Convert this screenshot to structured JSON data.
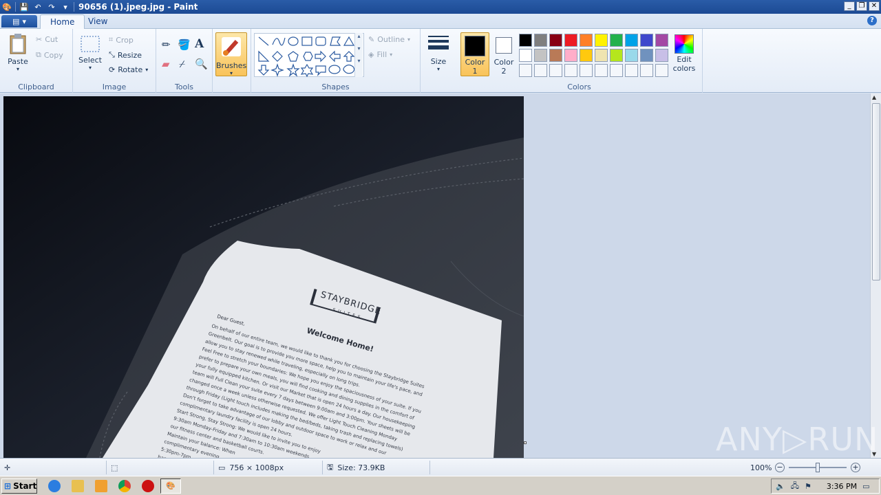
{
  "window": {
    "title": "90656 (1).jpeg.jpg - Paint",
    "minimize": "_",
    "restore": "❐",
    "close": "✕"
  },
  "tabs": {
    "home": "Home",
    "view": "View",
    "help": "?"
  },
  "clipboard": {
    "paste": "Paste",
    "cut": "Cut",
    "copy": "Copy",
    "label": "Clipboard"
  },
  "image": {
    "select": "Select",
    "crop": "Crop",
    "resize": "Resize",
    "rotate": "Rotate",
    "label": "Image"
  },
  "tools": {
    "label": "Tools",
    "text_glyph": "A"
  },
  "brushes": {
    "label": "Brushes"
  },
  "shapes": {
    "outline": "Outline",
    "fill": "Fill",
    "label": "Shapes"
  },
  "size": {
    "label": "Size"
  },
  "color1": {
    "label1": "Color",
    "label2": "1",
    "value": "#000000"
  },
  "color2": {
    "label1": "Color",
    "label2": "2",
    "value": "#ffffff"
  },
  "colors": {
    "label": "Colors",
    "row1": [
      "#000000",
      "#7f7f7f",
      "#880015",
      "#ed1c24",
      "#ff7f27",
      "#fff200",
      "#22b14c",
      "#00a2e8",
      "#3f48cc",
      "#a349a4"
    ],
    "row2": [
      "#ffffff",
      "#c3c3c3",
      "#b97a57",
      "#ffaec9",
      "#ffc90e",
      "#efe4b0",
      "#b5e61d",
      "#99d9ea",
      "#7092be",
      "#c8bfe7"
    ],
    "edit1": "Edit",
    "edit2": "colors"
  },
  "document": {
    "logo": "STAYBRIDGE",
    "logo_sub": "SUITES",
    "greeting": "Dear Guest,",
    "heading": "Welcome Home!",
    "lines": [
      "On behalf of our entire team, we would like to thank you for choosing the Staybridge Suites",
      "Greenbelt. Our goal is to provide you more space, help you to maintain your life's pace, and",
      "allow you to stay renewed while traveling, especially on long trips.",
      "Feel Free to stretch your boundaries: We hope you enjoy the spaciousness of your suite. If you",
      "prefer to prepare your own meals, you will find cooking and dining supplies in the comfort of",
      "your fully equipped kitchen. Or visit our Market that is open 24 hours a day. Our housekeeping",
      "team will Full Clean your suite every 7 days between 9:00am and 3:00pm. Your sheets will be",
      "changed once a week unless otherwise requested. We offer Light Touch Cleaning Monday",
      "through Friday (Light touch includes making the bed/beds, taking trash and replacing towels)",
      "Don't forget to take advantage of our lobby and outdoor space to work or relax and our",
      "complimentary laundry facility is open 24 hours.",
      "Start Strong, Stay Strong: We would like to invite you to enjoy",
      "9:30am Monday-Friday and 7:30am to 10:30am weekends.",
      "our fitness center and basketball courts.",
      "Maintain your balance: When",
      "complimentary evening",
      "5:30pm-7pm",
      "happ"
    ]
  },
  "status": {
    "dimensions": "756 × 1008px",
    "size": "Size: 73.9KB",
    "zoom": "100%",
    "zoom_level": 0.5
  },
  "taskbar": {
    "start": "Start",
    "clock": "3:36 PM"
  },
  "watermark": "ANY▷RUN"
}
